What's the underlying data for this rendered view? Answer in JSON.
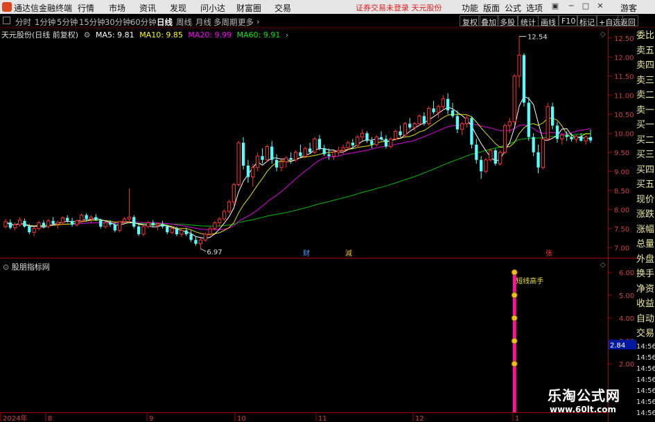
{
  "app": {
    "title": "通达信金融终端"
  },
  "menu": [
    "行情",
    "市场",
    "资讯",
    "发现",
    "问小达",
    "财富圈",
    "交易"
  ],
  "notice": "证券交易未登录  天元股份",
  "right_menu": [
    "功能",
    "版面",
    "公式",
    "选项",
    "游客"
  ],
  "periods": [
    "分时",
    "1分钟",
    "5分钟",
    "15分钟",
    "30分钟",
    "60分钟",
    "日线",
    "周线",
    "月线",
    "多周期",
    "更多"
  ],
  "active_period": "日线",
  "right_buttons": [
    "复权",
    "叠加",
    "多股",
    "统计",
    "画线",
    "F10",
    "标记",
    "+自选",
    "返回"
  ],
  "stock": {
    "label": "天元股份(日线 前复权)"
  },
  "ma_legend": [
    {
      "label": "MA5: 9.81",
      "color": "#ffffff"
    },
    {
      "label": "MA10: 9.85",
      "color": "#ffff00"
    },
    {
      "label": "MA20: 9.99",
      "color": "#ff00ff"
    },
    {
      "label": "MA60: 9.91",
      "color": "#00e000"
    }
  ],
  "indicator": {
    "title": "股朋指标网",
    "label": "短线高手",
    "axis": [
      "6.00",
      "5.00",
      "4.00",
      "3.00",
      "2.00"
    ],
    "current_value": "2.84"
  },
  "sidebar": [
    "委比",
    "卖五",
    "卖四",
    "卖三",
    "卖二",
    "卖一",
    "买一",
    "买二",
    "买三",
    "买四",
    "买五",
    "现价",
    "涨跌",
    "涨幅",
    "总量",
    "外盘",
    "换手",
    "净资",
    "收益",
    "自动",
    "交易",
    "14:56",
    "14:56",
    "14:56",
    "14:56",
    "14:56",
    "14:56",
    "14:56"
  ],
  "watermark": {
    "cn": "乐淘公式网",
    "url": "www.60lt.com"
  },
  "chart_data": {
    "type": "candlestick",
    "ylim": [
      6.75,
      12.75
    ],
    "y_ticks": [
      "12.50",
      "12.00",
      "11.50",
      "11.00",
      "10.50",
      "10.00",
      "9.50",
      "9.00",
      "8.50",
      "8.00",
      "7.50",
      "7.00"
    ],
    "x_ticks": [
      "2024年",
      "8",
      "9",
      "10",
      "11",
      "12",
      "1"
    ],
    "annotations": [
      {
        "text": "12.54",
        "kind": "high"
      },
      {
        "text": "6.97",
        "kind": "low"
      }
    ],
    "markers": [
      {
        "text": "财",
        "color": "#4aa3ff"
      },
      {
        "text": "減",
        "color": "#f0c020"
      },
      {
        "text": "张",
        "color": "#ff3030"
      }
    ],
    "candles": [
      [
        7.55,
        7.75,
        7.5,
        7.68
      ],
      [
        7.66,
        7.74,
        7.48,
        7.52
      ],
      [
        7.52,
        7.66,
        7.45,
        7.6
      ],
      [
        7.6,
        7.8,
        7.55,
        7.72
      ],
      [
        7.7,
        7.76,
        7.52,
        7.55
      ],
      [
        7.55,
        7.62,
        7.35,
        7.4
      ],
      [
        7.4,
        7.55,
        7.3,
        7.5
      ],
      [
        7.5,
        7.7,
        7.45,
        7.65
      ],
      [
        7.65,
        7.72,
        7.5,
        7.55
      ],
      [
        7.55,
        7.75,
        7.5,
        7.7
      ],
      [
        7.7,
        7.8,
        7.6,
        7.62
      ],
      [
        7.62,
        7.7,
        7.5,
        7.66
      ],
      [
        7.66,
        7.82,
        7.6,
        7.78
      ],
      [
        7.78,
        7.85,
        7.65,
        7.7
      ],
      [
        7.7,
        7.78,
        7.55,
        7.6
      ],
      [
        7.6,
        7.74,
        7.55,
        7.7
      ],
      [
        7.7,
        7.9,
        7.65,
        7.85
      ],
      [
        7.85,
        7.9,
        7.7,
        7.75
      ],
      [
        7.75,
        7.85,
        7.65,
        7.8
      ],
      [
        7.8,
        7.88,
        7.7,
        7.72
      ],
      [
        7.72,
        7.76,
        7.5,
        7.55
      ],
      [
        7.55,
        7.68,
        7.5,
        7.65
      ],
      [
        7.65,
        7.72,
        7.55,
        7.6
      ],
      [
        7.6,
        7.65,
        7.4,
        7.45
      ],
      [
        7.45,
        7.7,
        7.4,
        7.68
      ],
      [
        7.68,
        7.8,
        7.6,
        7.75
      ],
      [
        7.75,
        8.55,
        7.65,
        7.8
      ],
      [
        7.8,
        7.85,
        7.5,
        7.55
      ],
      [
        7.55,
        7.62,
        7.3,
        7.35
      ],
      [
        7.35,
        7.58,
        7.3,
        7.55
      ],
      [
        7.55,
        7.7,
        7.5,
        7.65
      ],
      [
        7.65,
        7.72,
        7.55,
        7.58
      ],
      [
        7.58,
        7.66,
        7.45,
        7.62
      ],
      [
        7.62,
        7.7,
        7.5,
        7.55
      ],
      [
        7.55,
        7.6,
        7.35,
        7.4
      ],
      [
        7.4,
        7.55,
        7.35,
        7.5
      ],
      [
        7.5,
        7.55,
        7.3,
        7.35
      ],
      [
        7.35,
        7.5,
        7.28,
        7.45
      ],
      [
        7.45,
        7.52,
        7.3,
        7.35
      ],
      [
        7.35,
        7.45,
        7.15,
        7.2
      ],
      [
        7.2,
        7.3,
        7.05,
        7.1
      ],
      [
        7.1,
        7.25,
        6.97,
        7.2
      ],
      [
        7.2,
        7.4,
        7.15,
        7.35
      ],
      [
        7.35,
        7.55,
        7.3,
        7.5
      ],
      [
        7.5,
        7.7,
        7.45,
        7.65
      ],
      [
        7.65,
        7.8,
        7.55,
        7.75
      ],
      [
        7.75,
        8.0,
        7.7,
        7.95
      ],
      [
        7.95,
        8.25,
        7.9,
        8.2
      ],
      [
        8.2,
        8.7,
        8.1,
        8.65
      ],
      [
        8.65,
        9.8,
        8.6,
        9.75
      ],
      [
        9.75,
        9.9,
        9.05,
        9.15
      ],
      [
        9.15,
        9.3,
        8.7,
        8.85
      ],
      [
        8.85,
        9.2,
        8.6,
        9.1
      ],
      [
        9.1,
        9.5,
        9.0,
        9.4
      ],
      [
        9.4,
        9.6,
        9.2,
        9.3
      ],
      [
        9.3,
        9.7,
        9.25,
        9.65
      ],
      [
        9.65,
        9.8,
        9.2,
        9.3
      ],
      [
        9.3,
        9.45,
        9.0,
        9.1
      ],
      [
        9.1,
        9.35,
        9.0,
        9.25
      ],
      [
        9.25,
        9.4,
        9.1,
        9.35
      ],
      [
        9.35,
        9.5,
        9.2,
        9.3
      ],
      [
        9.3,
        9.55,
        9.25,
        9.5
      ],
      [
        9.5,
        9.7,
        9.35,
        9.4
      ],
      [
        9.4,
        9.65,
        9.35,
        9.6
      ],
      [
        9.6,
        9.75,
        9.45,
        9.5
      ],
      [
        9.5,
        9.9,
        9.45,
        9.85
      ],
      [
        9.85,
        9.95,
        9.55,
        9.6
      ],
      [
        9.6,
        9.7,
        9.4,
        9.45
      ],
      [
        9.45,
        9.6,
        9.3,
        9.4
      ],
      [
        9.4,
        9.55,
        9.3,
        9.5
      ],
      [
        9.5,
        9.65,
        9.4,
        9.55
      ],
      [
        9.55,
        9.7,
        9.45,
        9.62
      ],
      [
        9.62,
        9.8,
        9.55,
        9.75
      ],
      [
        9.75,
        9.85,
        9.6,
        9.68
      ],
      [
        9.68,
        9.95,
        9.62,
        9.9
      ],
      [
        9.9,
        10.1,
        9.8,
        10.0
      ],
      [
        10.0,
        10.05,
        9.75,
        9.8
      ],
      [
        9.8,
        9.9,
        9.6,
        9.7
      ],
      [
        9.7,
        9.95,
        9.65,
        9.9
      ],
      [
        9.9,
        10.05,
        9.8,
        9.85
      ],
      [
        9.85,
        9.95,
        9.6,
        9.65
      ],
      [
        9.65,
        9.9,
        9.6,
        9.85
      ],
      [
        9.85,
        10.1,
        9.8,
        10.05
      ],
      [
        10.05,
        10.2,
        9.9,
        9.95
      ],
      [
        9.95,
        10.3,
        9.9,
        10.25
      ],
      [
        10.25,
        10.4,
        10.1,
        10.15
      ],
      [
        10.15,
        10.3,
        10.05,
        10.25
      ],
      [
        10.25,
        10.5,
        10.2,
        10.45
      ],
      [
        10.45,
        10.55,
        10.2,
        10.25
      ],
      [
        10.25,
        10.7,
        10.2,
        10.65
      ],
      [
        10.65,
        10.85,
        10.5,
        10.55
      ],
      [
        10.55,
        10.75,
        10.4,
        10.7
      ],
      [
        10.7,
        11.0,
        10.6,
        10.9
      ],
      [
        10.9,
        11.05,
        10.5,
        10.6
      ],
      [
        10.6,
        10.8,
        10.4,
        10.45
      ],
      [
        10.45,
        10.6,
        10.0,
        10.1
      ],
      [
        10.1,
        10.3,
        9.95,
        10.25
      ],
      [
        10.25,
        10.5,
        10.15,
        10.4
      ],
      [
        10.4,
        10.45,
        9.6,
        9.7
      ],
      [
        9.7,
        9.85,
        9.2,
        9.3
      ],
      [
        9.3,
        9.4,
        8.8,
        9.0
      ],
      [
        9.0,
        9.35,
        8.95,
        9.3
      ],
      [
        9.3,
        9.6,
        9.25,
        9.55
      ],
      [
        9.55,
        9.6,
        9.15,
        9.2
      ],
      [
        9.2,
        9.55,
        9.15,
        9.5
      ],
      [
        9.5,
        10.25,
        9.45,
        10.2
      ],
      [
        10.2,
        10.4,
        10.0,
        10.3
      ],
      [
        10.3,
        11.55,
        10.2,
        11.5
      ],
      [
        11.5,
        12.54,
        11.2,
        12.05
      ],
      [
        12.05,
        12.1,
        10.7,
        10.8
      ],
      [
        10.8,
        10.95,
        9.8,
        9.9
      ],
      [
        9.9,
        10.0,
        9.4,
        9.5
      ],
      [
        9.5,
        9.7,
        8.95,
        9.1
      ],
      [
        9.1,
        9.9,
        9.05,
        9.85
      ],
      [
        9.85,
        10.8,
        9.8,
        10.7
      ],
      [
        10.7,
        10.8,
        10.1,
        10.2
      ],
      [
        10.2,
        10.3,
        9.75,
        9.85
      ],
      [
        9.85,
        10.0,
        9.7,
        9.95
      ],
      [
        9.95,
        10.05,
        9.8,
        9.9
      ],
      [
        9.9,
        10.0,
        9.78,
        9.84
      ],
      [
        9.84,
        9.95,
        9.75,
        9.92
      ],
      [
        9.92,
        10.0,
        9.78,
        9.8
      ],
      [
        9.8,
        9.95,
        9.7,
        9.9
      ],
      [
        9.9,
        10.1,
        9.75,
        9.81
      ]
    ]
  }
}
